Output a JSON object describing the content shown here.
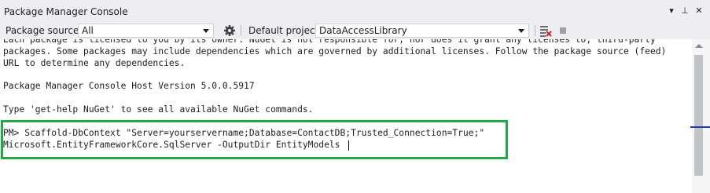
{
  "window": {
    "title": "Package Manager Console",
    "controls": {
      "dropdown": "▾",
      "pin": "⊥",
      "close": "✕"
    }
  },
  "toolbar": {
    "package_source_label": "Package source:",
    "package_source_value": "All",
    "default_project_label": "Default project:",
    "default_project_value": "DataAccessLibrary",
    "icons": [
      "gear-icon",
      "clear-console-icon",
      "stop-icon"
    ]
  },
  "console": {
    "lines": [
      "Each package is licensed to you by its owner. NuGet is not responsible for, nor does it grant any licenses to, third-party",
      "packages. Some packages may include dependencies which are governed by additional licenses. Follow the package source (feed)",
      "URL to determine any dependencies.",
      "",
      "Package Manager Console Host Version 5.0.0.5917",
      "",
      "Type 'get-help NuGet' to see all available NuGet commands.",
      "",
      "PM> Scaffold-DbContext \"Server=yourservername;Database=ContactDB;Trusted_Connection=True;\"",
      "Microsoft.EntityFrameworkCore.SqlServer -OutputDir EntityModels"
    ]
  },
  "colors": {
    "highlight_border": "#22a845",
    "chrome_bg": "#eeeef2",
    "scroll_marker": "#1a3bb8"
  }
}
